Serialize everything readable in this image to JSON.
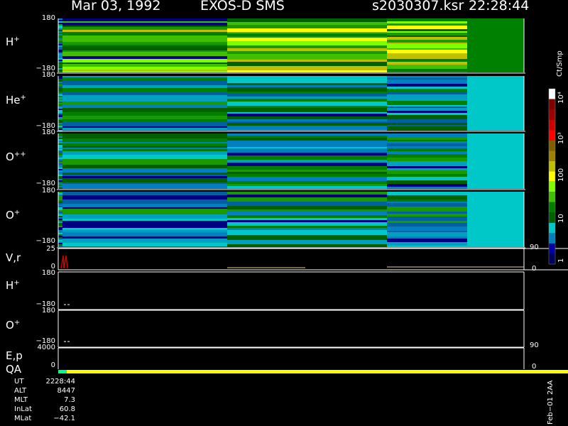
{
  "header": {
    "date": "Mar 03, 1992",
    "mission": "EXOS-D SMS",
    "file": "s2030307.ksr",
    "time": "22:28:44"
  },
  "panels": {
    "h_plus": {
      "label_base": "H",
      "label_sup": "+",
      "top_tick": "180",
      "bottom_tick": "−180"
    },
    "he_plus": {
      "label_base": "He",
      "label_sup": "+",
      "top_tick": "180",
      "bottom_tick": "−180"
    },
    "o_pp": {
      "label_base": "O",
      "label_sup": "++",
      "top_tick": "180",
      "bottom_tick": "−180"
    },
    "o_plus": {
      "label_base": "O",
      "label_sup": "+",
      "top_tick": "180",
      "bottom_tick": "−180"
    },
    "vr": {
      "label": "V,r",
      "top_tick": "25",
      "bottom_tick": "0",
      "right_top": "90",
      "right_bottom": "0"
    },
    "h_plus_2": {
      "label_base": "H",
      "label_sup": "+",
      "top_tick": "180",
      "bottom_tick": "−180"
    },
    "o_plus_2": {
      "label_base": "O",
      "label_sup": "+",
      "top_tick": "180",
      "bottom_tick": "−180"
    },
    "ep": {
      "label": "E,p",
      "top_tick": "4000",
      "bottom_tick": "0",
      "right_top": "90",
      "right_bottom": "0"
    },
    "qa": {
      "label": "QA"
    }
  },
  "colorbar": {
    "unit": "Ct/Smp",
    "labels": [
      "10⁴",
      "10³",
      "100",
      "10",
      "1"
    ],
    "colors": [
      "#ffffff",
      "#800000",
      "#a00000",
      "#d00000",
      "#ff0000",
      "#806000",
      "#a08000",
      "#c0c000",
      "#ffff00",
      "#80ff00",
      "#40c000",
      "#008000",
      "#006000",
      "#00c8c8",
      "#0080c0",
      "#0000a0",
      "#000060"
    ]
  },
  "footer": {
    "rows": [
      {
        "key": "UT",
        "value": "2228:44"
      },
      {
        "key": "ALT",
        "value": "8447"
      },
      {
        "key": "MLT",
        "value": "7.3"
      },
      {
        "key": "InLat",
        "value": "60.8"
      },
      {
        "key": "MLat",
        "value": "−42.1"
      }
    ],
    "stamp": "Feb−01 2AA"
  },
  "chart_data": {
    "type": "heatmap",
    "title": "",
    "panels": [
      "H+",
      "He+",
      "O++",
      "O+",
      "V,r",
      "H+",
      "O+",
      "E,p",
      "QA"
    ],
    "y_range": [
      -180,
      180
    ],
    "color_scale": "log",
    "unit": "Ct/Smp",
    "colorbar_range": [
      1,
      10000
    ]
  }
}
